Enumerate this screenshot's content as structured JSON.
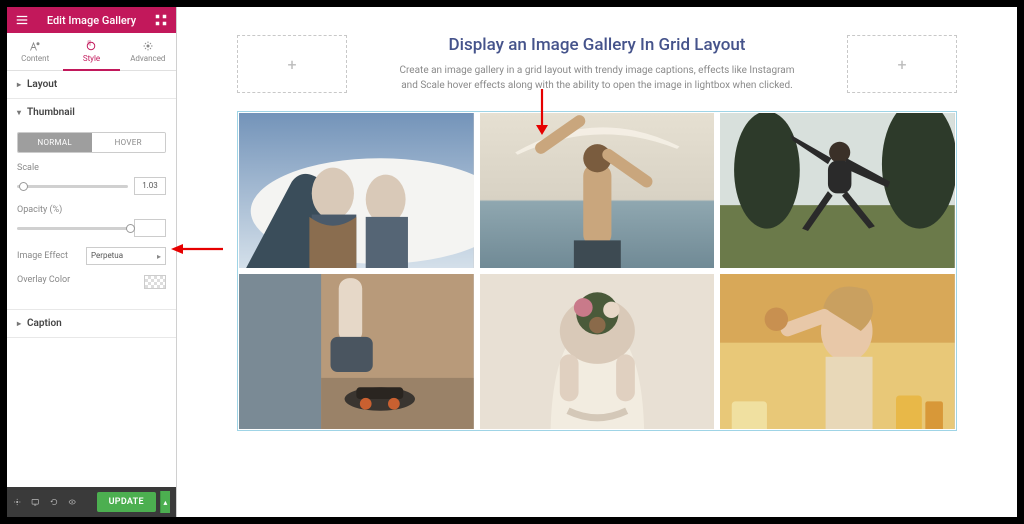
{
  "header": {
    "title": "Edit Image Gallery"
  },
  "tabs": {
    "content": "Content",
    "style": "Style",
    "advanced": "Advanced"
  },
  "sections": {
    "layout": "Layout",
    "thumbnail": "Thumbnail",
    "caption": "Caption"
  },
  "thumbnail": {
    "normal": "NORMAL",
    "hover": "HOVER",
    "scale_label": "Scale",
    "scale_value": "1.03",
    "opacity_label": "Opacity (%)",
    "opacity_value": "",
    "effect_label": "Image Effect",
    "effect_value": "Perpetua",
    "overlay_label": "Overlay Color"
  },
  "footer": {
    "update": "UPDATE"
  },
  "hero": {
    "title": "Display an Image Gallery In Grid Layout",
    "desc": "Create an image gallery in a grid layout with trendy image captions, effects like Instagram and Scale hover effects along with the ability to open the image in lightbox when clicked."
  }
}
